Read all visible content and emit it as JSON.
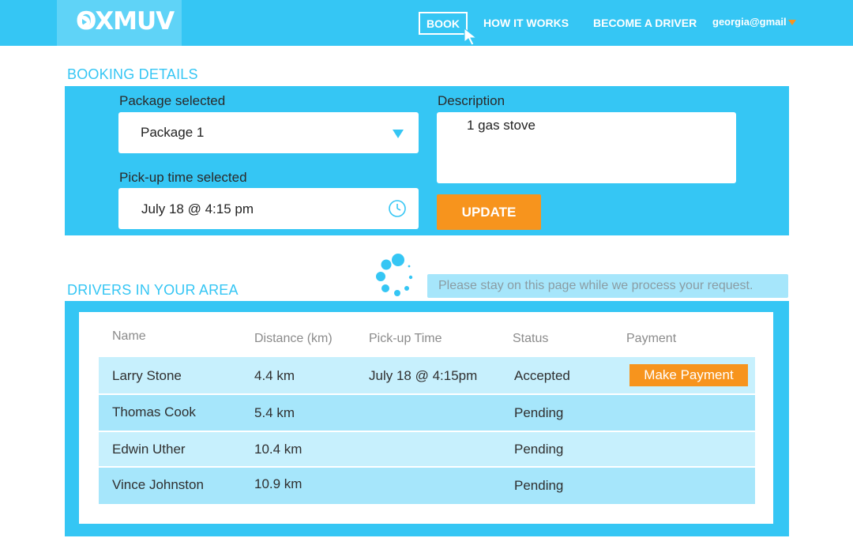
{
  "header": {
    "logo_text": "OXMUV",
    "nav": {
      "book": "BOOK",
      "how_it_works": "HOW IT WORKS",
      "become_driver": "BECOME A DRIVER",
      "user": "georgia@gmail"
    }
  },
  "booking": {
    "title": "BOOKING DETAILS",
    "package_label": "Package selected",
    "package_value": "Package 1",
    "pickup_label": "Pick-up time selected",
    "pickup_value": "July 18 @ 4:15 pm",
    "description_label": "Description",
    "description_value": "1 gas stove",
    "update_label": "UPDATE"
  },
  "drivers": {
    "title": "DRIVERS IN YOUR AREA",
    "notice": "Please stay on this page while we process your request.",
    "columns": [
      "Name",
      "Distance (km)",
      "Pick-up Time",
      "Status",
      "Payment"
    ],
    "rows": [
      {
        "name": "Larry Stone",
        "distance": "4.4 km",
        "pickup": "July 18 @ 4:15pm",
        "status": "Accepted",
        "payment": "Make Payment"
      },
      {
        "name": "Thomas Cook",
        "distance": "5.4 km",
        "pickup": "",
        "status": "Pending",
        "payment": ""
      },
      {
        "name": "Edwin Uther",
        "distance": "10.4 km",
        "pickup": "",
        "status": "Pending",
        "payment": ""
      },
      {
        "name": "Vince Johnston",
        "distance": "10.9 km",
        "pickup": "",
        "status": "Pending",
        "payment": ""
      }
    ]
  },
  "colors": {
    "primary": "#35c6f4",
    "accent": "#f7941d",
    "row_light": "#c7f0fd",
    "row_dark": "#a6e6fb"
  },
  "icons": {
    "logo": "ox-head-logo",
    "dropdown": "chevron-down-icon",
    "clock": "clock-icon",
    "spinner": "loading-spinner-icon",
    "cursor": "mouse-pointer-icon",
    "user_menu": "caret-down-icon"
  }
}
